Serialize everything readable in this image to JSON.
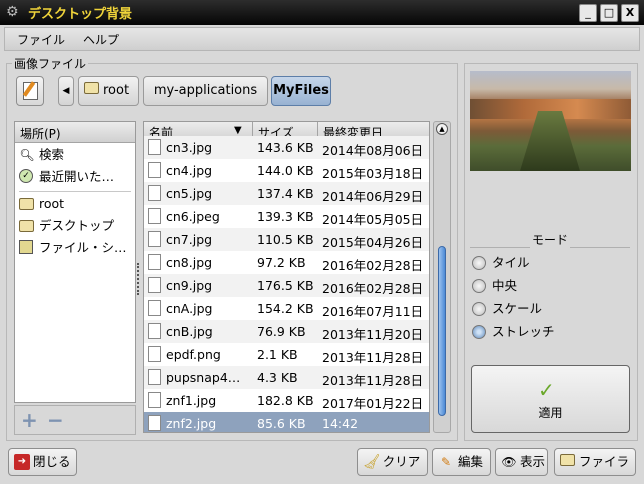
{
  "window": {
    "title": "デスクトップ背景",
    "min": "_",
    "max": "□",
    "close": "X"
  },
  "menu": {
    "file": "ファイル",
    "help": "ヘルプ"
  },
  "group_label": "画像ファイル",
  "breadcrumb": {
    "back": "◀",
    "items": [
      "root",
      "my-applications",
      "MyFiles"
    ]
  },
  "places": {
    "header": "場所(P)",
    "items": [
      {
        "label": "検索",
        "icon": "search-icon"
      },
      {
        "label": "最近開いた…",
        "icon": "recent-icon"
      },
      {
        "label": "root",
        "icon": "folder-icon"
      },
      {
        "label": "デスクトップ",
        "icon": "folder-icon"
      },
      {
        "label": "ファイル・シ…",
        "icon": "drive-icon"
      }
    ],
    "add": "+",
    "remove": "−"
  },
  "files": {
    "headers": {
      "name": "名前",
      "size": "サイズ",
      "date": "最終変更日"
    },
    "rows": [
      {
        "name": "cn3.jpg",
        "size": "143.6 KB",
        "date": "2014年08月06日"
      },
      {
        "name": "cn4.jpg",
        "size": "144.0 KB",
        "date": "2015年03月18日"
      },
      {
        "name": "cn5.jpg",
        "size": "137.4 KB",
        "date": "2014年06月29日"
      },
      {
        "name": "cn6.jpeg",
        "size": "139.3 KB",
        "date": "2014年05月05日"
      },
      {
        "name": "cn7.jpg",
        "size": "110.5 KB",
        "date": "2015年04月26日"
      },
      {
        "name": "cn8.jpg",
        "size": "97.2 KB",
        "date": "2016年02月28日"
      },
      {
        "name": "cn9.jpg",
        "size": "176.5 KB",
        "date": "2016年02月28日"
      },
      {
        "name": "cnA.jpg",
        "size": "154.2 KB",
        "date": "2016年07月11日"
      },
      {
        "name": "cnB.jpg",
        "size": "76.9 KB",
        "date": "2013年11月20日"
      },
      {
        "name": "epdf.png",
        "size": "2.1 KB",
        "date": "2013年11月28日"
      },
      {
        "name": "pupsnap4…",
        "size": "4.3 KB",
        "date": "2013年11月28日"
      },
      {
        "name": "znf1.jpg",
        "size": "182.8 KB",
        "date": "2017年01月22日"
      },
      {
        "name": "znf2.jpg",
        "size": "85.6 KB",
        "date": "14:42"
      }
    ],
    "selected": "znf2.jpg"
  },
  "mode": {
    "label": "モード",
    "options": [
      "タイル",
      "中央",
      "スケール",
      "ストレッチ"
    ],
    "selected": "ストレッチ"
  },
  "apply": "適用",
  "buttons": {
    "close": "閉じる",
    "clear": "クリア",
    "edit": "編集",
    "view": "表示",
    "filer": "ファイラ"
  }
}
